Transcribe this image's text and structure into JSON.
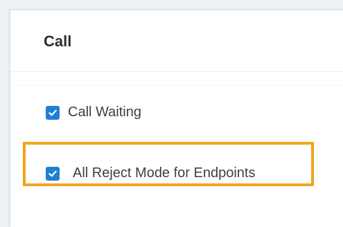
{
  "section": {
    "title": "Call"
  },
  "options": {
    "call_waiting": {
      "label": "Call Waiting",
      "checked": true
    },
    "all_reject_mode": {
      "label": "All Reject Mode for Endpoints",
      "checked": true
    }
  },
  "colors": {
    "checkbox_fill": "#1f7fd4",
    "highlight": "#f4a51c",
    "title_text": "#2b2f36",
    "label_text": "#3a3f46"
  },
  "icons": {
    "checkbox": "checkmark-icon"
  }
}
